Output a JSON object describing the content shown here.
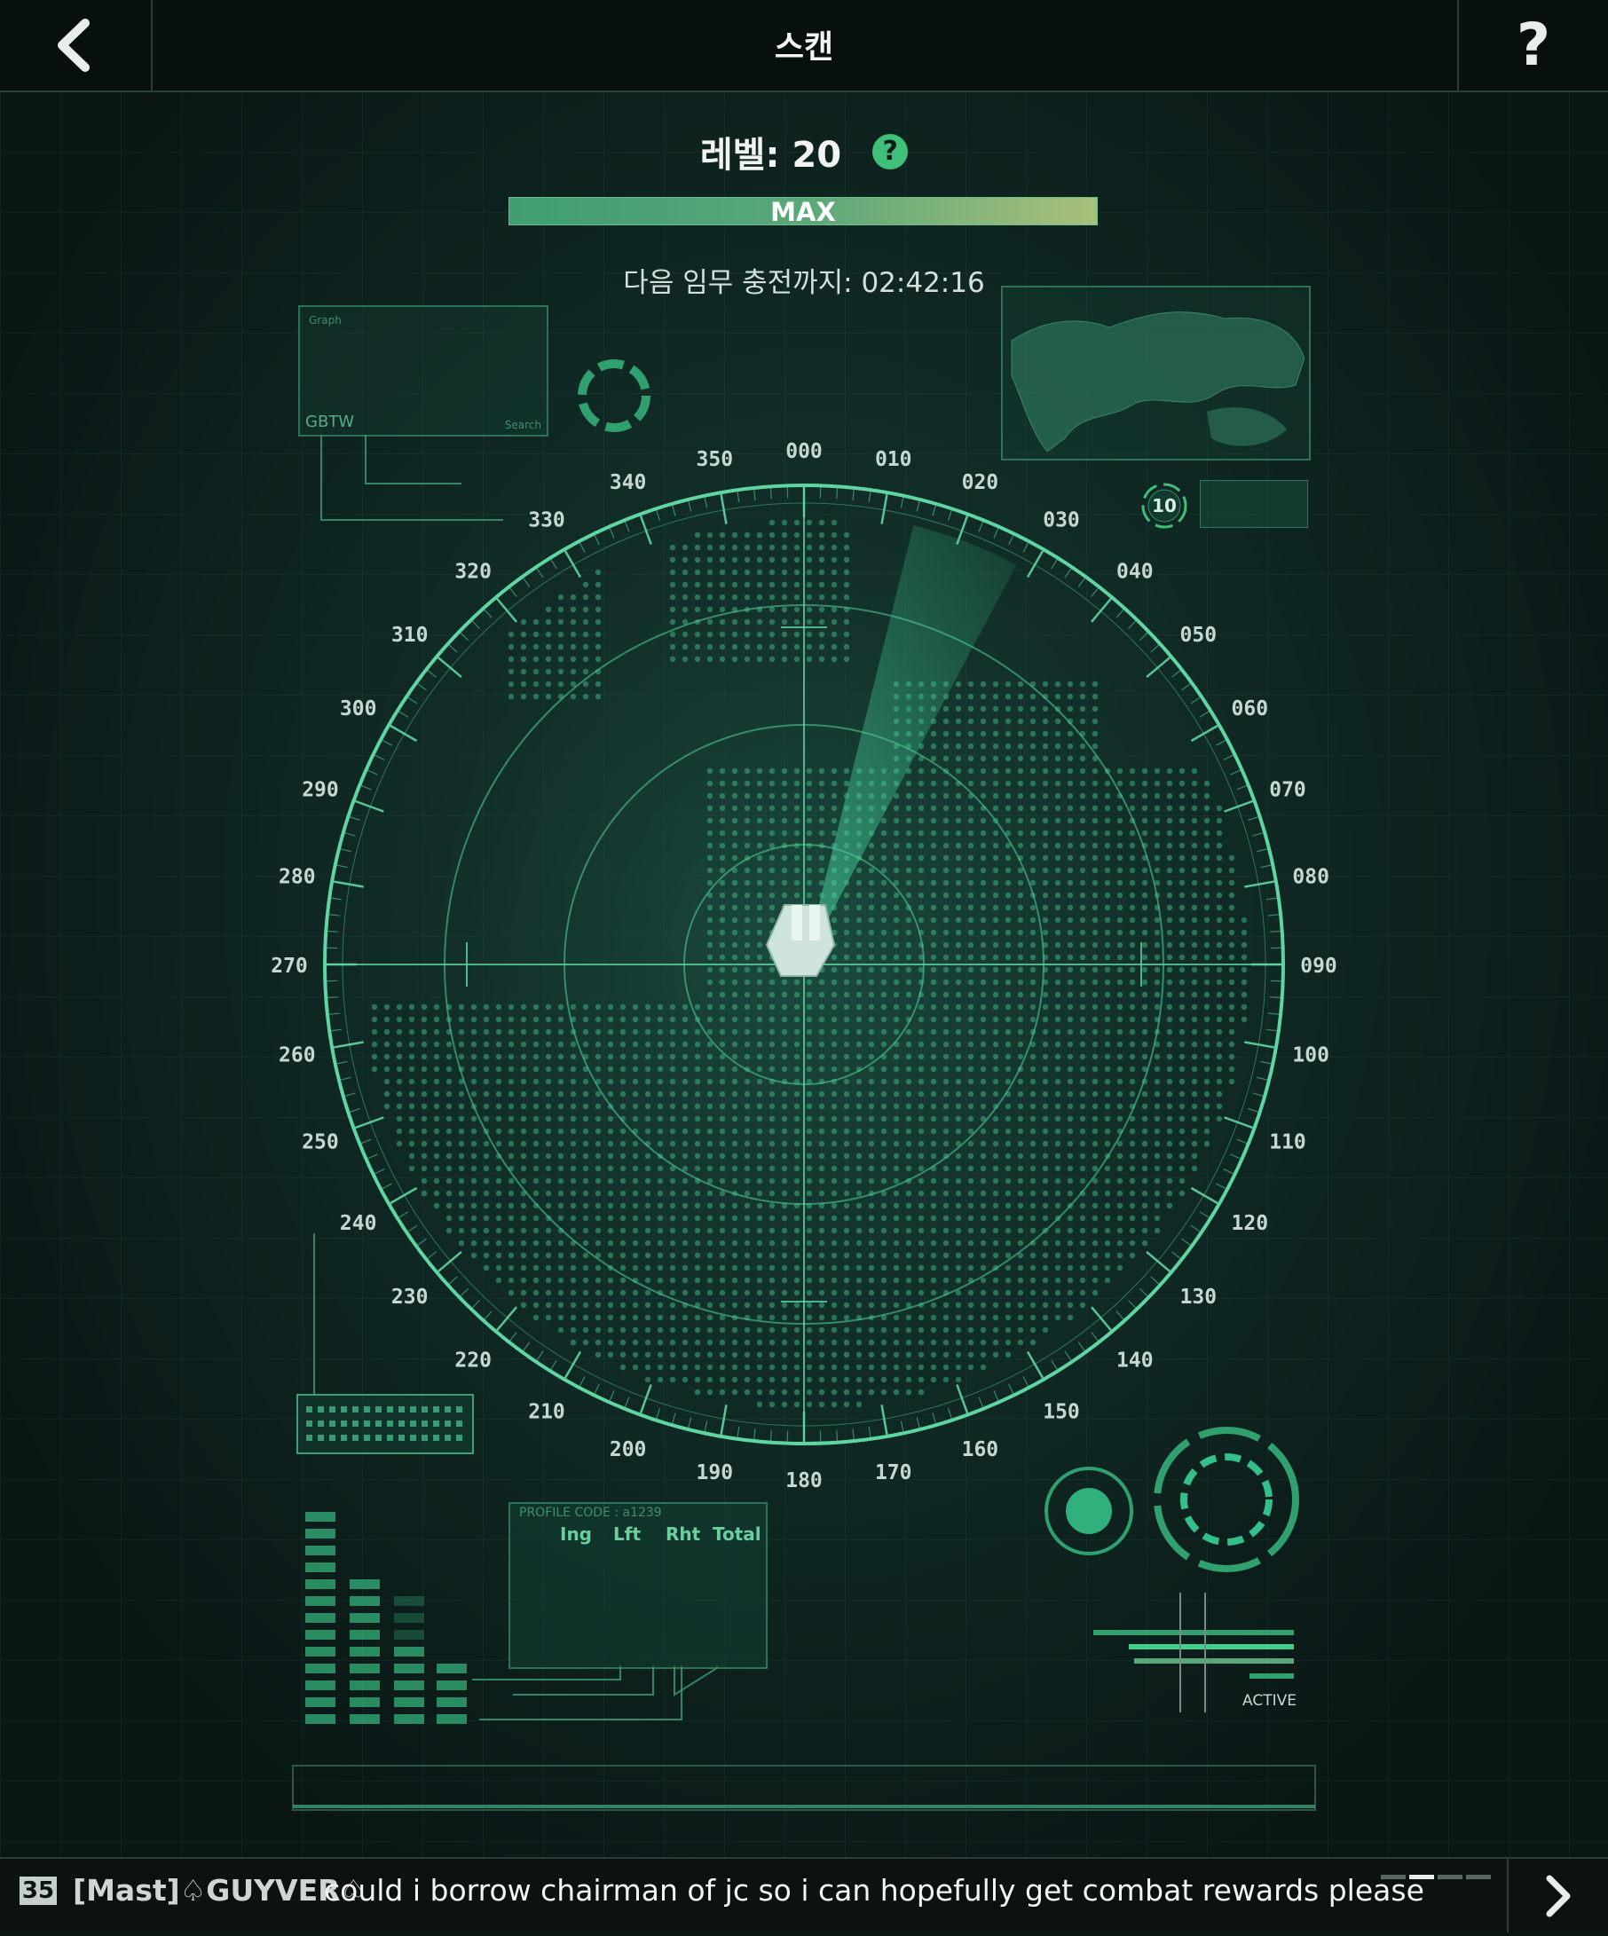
{
  "header": {
    "title": "스캔",
    "back_icon": "chevron-left-icon",
    "help_label": "?"
  },
  "level": {
    "label": "레벨: 20",
    "help_label": "?",
    "bar_label": "MAX",
    "progress": 1.0
  },
  "timer": {
    "text": "다음 임무 충전까지: 02:42:16"
  },
  "radar": {
    "bearings": [
      "000",
      "010",
      "020",
      "030",
      "040",
      "050",
      "060",
      "070",
      "080",
      "090",
      "100",
      "110",
      "120",
      "130",
      "140",
      "150",
      "160",
      "170",
      "180",
      "190",
      "200",
      "210",
      "220",
      "230",
      "240",
      "250",
      "260",
      "270",
      "280",
      "290",
      "300",
      "310",
      "320",
      "330",
      "340",
      "350"
    ],
    "sweep_bearing_degrees": 28
  },
  "decor": {
    "graph_panel": {
      "brand": "GBTW",
      "title": "Graph",
      "search": "Search"
    },
    "badge_number": "10",
    "profile": {
      "code": "PROFILE CODE : a1239",
      "columns": [
        "Ing",
        "Lft",
        "Rht",
        "Total"
      ]
    },
    "status_label": "ACTIVE"
  },
  "chat": {
    "badge": "35",
    "sender": "[Mast]♤GUYVER♤",
    "message": "could i borrow chairman of jc so i can hopefully get combat rewards please",
    "next_icon": "chevron-right-icon"
  },
  "colors": {
    "accent": "#3fbf78",
    "radar_line": "#5fd6a2",
    "background": "#0a1614"
  }
}
